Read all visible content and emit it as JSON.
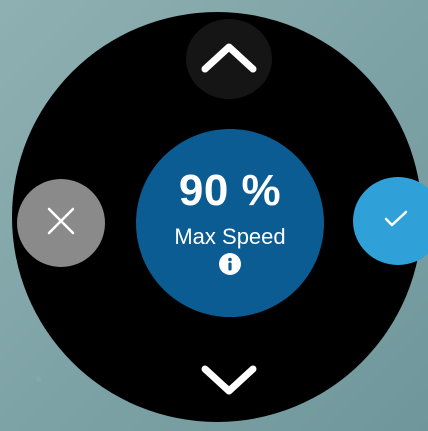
{
  "screen": {
    "value": "90 %",
    "label": "Max Speed"
  },
  "icons": {
    "up": "chevron-up-icon",
    "down": "chevron-down-icon",
    "info": "info-icon",
    "cancel": "close-icon",
    "confirm": "checkmark-icon"
  },
  "colors": {
    "face": "#000000",
    "center": "#0b5c92",
    "cancel": "#8a8a8a",
    "confirm": "#2fa1d8",
    "up_button_bg": "#151515",
    "background": "#7ea3a6"
  }
}
